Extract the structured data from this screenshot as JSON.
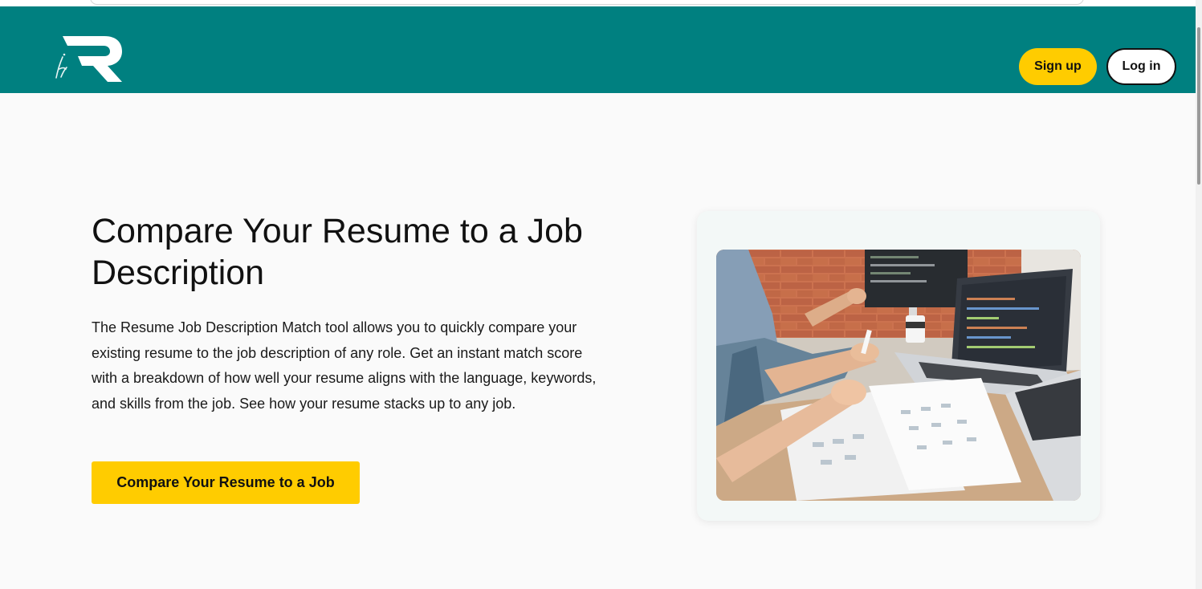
{
  "header": {
    "logo_icon": "r-logo-icon",
    "signup_label": "Sign up",
    "login_label": "Log in"
  },
  "hero": {
    "title": "Compare Your Resume to a Job Description",
    "description": "The Resume Job Description Match tool allows you to quickly compare your existing resume to the job description of any role. Get an instant match score with a breakdown of how well your resume aligns with the language, keywords, and skills from the job. See how your resume stacks up to any job.",
    "cta_label": "Compare Your Resume to a Job",
    "image_icon": "workspace-photo-icon"
  },
  "colors": {
    "header_bg": "#008080",
    "accent": "#ffcc00",
    "page_bg": "#fafafa",
    "text": "#111111"
  }
}
